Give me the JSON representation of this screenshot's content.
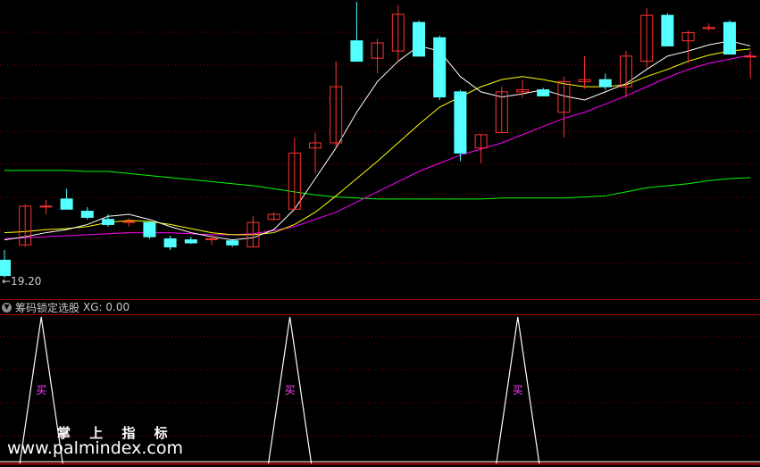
{
  "indicator": {
    "name": "筹码锁定选股",
    "output": "XG: 0.00",
    "signal_label": "买"
  },
  "watermark": {
    "line1": "掌 上 指 标",
    "line2": "www.palmindex.com"
  },
  "low_marker": "←19.20",
  "colors": {
    "up": "#ff3232",
    "down": "#54ffff",
    "ma5": "#ffffff",
    "ma10": "#ffff00",
    "ma20": "#ff00ff",
    "ma60": "#00ff00",
    "grid": "#8b0000",
    "border": "#b00000"
  },
  "chart_data": {
    "type": "candlestick",
    "price_range": [
      19.1,
      21.9
    ],
    "candles": [
      {
        "o": 19.35,
        "h": 19.45,
        "l": 19.18,
        "c": 19.2
      },
      {
        "o": 19.5,
        "h": 19.9,
        "l": 19.48,
        "c": 19.88
      },
      {
        "o": 19.88,
        "h": 19.94,
        "l": 19.8,
        "c": 19.88
      },
      {
        "o": 19.95,
        "h": 20.05,
        "l": 19.85,
        "c": 19.85
      },
      {
        "o": 19.83,
        "h": 19.87,
        "l": 19.75,
        "c": 19.77
      },
      {
        "o": 19.75,
        "h": 19.8,
        "l": 19.68,
        "c": 19.7
      },
      {
        "o": 19.72,
        "h": 19.76,
        "l": 19.68,
        "c": 19.73
      },
      {
        "o": 19.72,
        "h": 19.73,
        "l": 19.56,
        "c": 19.58
      },
      {
        "o": 19.56,
        "h": 19.59,
        "l": 19.45,
        "c": 19.48
      },
      {
        "o": 19.55,
        "h": 19.58,
        "l": 19.51,
        "c": 19.52
      },
      {
        "o": 19.56,
        "h": 19.6,
        "l": 19.5,
        "c": 19.56
      },
      {
        "o": 19.54,
        "h": 19.55,
        "l": 19.48,
        "c": 19.5
      },
      {
        "o": 19.48,
        "h": 19.78,
        "l": 19.48,
        "c": 19.72
      },
      {
        "o": 19.75,
        "h": 19.82,
        "l": 19.74,
        "c": 19.8
      },
      {
        "o": 19.85,
        "h": 20.55,
        "l": 19.85,
        "c": 20.4
      },
      {
        "o": 20.45,
        "h": 20.6,
        "l": 20.2,
        "c": 20.5
      },
      {
        "o": 20.5,
        "h": 21.3,
        "l": 20.45,
        "c": 21.05
      },
      {
        "o": 21.5,
        "h": 21.88,
        "l": 21.3,
        "c": 21.3
      },
      {
        "o": 21.33,
        "h": 21.52,
        "l": 21.18,
        "c": 21.48
      },
      {
        "o": 21.4,
        "h": 21.85,
        "l": 21.3,
        "c": 21.76
      },
      {
        "o": 21.68,
        "h": 21.7,
        "l": 21.35,
        "c": 21.35
      },
      {
        "o": 21.53,
        "h": 21.55,
        "l": 20.92,
        "c": 20.95
      },
      {
        "o": 21.0,
        "h": 21.02,
        "l": 20.32,
        "c": 20.4
      },
      {
        "o": 20.45,
        "h": 20.58,
        "l": 20.3,
        "c": 20.58
      },
      {
        "o": 20.6,
        "h": 21.05,
        "l": 20.6,
        "c": 21.0
      },
      {
        "o": 21.0,
        "h": 21.12,
        "l": 20.95,
        "c": 21.02
      },
      {
        "o": 21.02,
        "h": 21.04,
        "l": 20.96,
        "c": 20.96
      },
      {
        "o": 20.8,
        "h": 21.15,
        "l": 20.55,
        "c": 21.1
      },
      {
        "o": 21.1,
        "h": 21.35,
        "l": 21.03,
        "c": 21.12
      },
      {
        "o": 21.12,
        "h": 21.18,
        "l": 21.02,
        "c": 21.05
      },
      {
        "o": 21.05,
        "h": 21.4,
        "l": 20.95,
        "c": 21.35
      },
      {
        "o": 21.3,
        "h": 21.82,
        "l": 21.23,
        "c": 21.75
      },
      {
        "o": 21.75,
        "h": 21.77,
        "l": 21.45,
        "c": 21.45
      },
      {
        "o": 21.5,
        "h": 21.6,
        "l": 21.28,
        "c": 21.58
      },
      {
        "o": 21.62,
        "h": 21.67,
        "l": 21.6,
        "c": 21.63
      },
      {
        "o": 21.68,
        "h": 21.7,
        "l": 21.37,
        "c": 21.37
      },
      {
        "o": 21.35,
        "h": 21.4,
        "l": 21.13,
        "c": 21.35
      }
    ],
    "ma5": [
      19.55,
      19.58,
      19.62,
      19.65,
      19.7,
      19.78,
      19.8,
      19.75,
      19.68,
      19.62,
      19.58,
      19.55,
      19.57,
      19.65,
      19.85,
      20.15,
      20.45,
      20.8,
      21.1,
      21.3,
      21.45,
      21.4,
      21.15,
      21.0,
      20.95,
      20.98,
      21.02,
      20.96,
      20.92,
      21.0,
      21.08,
      21.22,
      21.35,
      21.4,
      21.46,
      21.5,
      21.45
    ],
    "ma10": [
      19.62,
      19.63,
      19.65,
      19.66,
      19.68,
      19.72,
      19.74,
      19.73,
      19.7,
      19.66,
      19.62,
      19.6,
      19.6,
      19.62,
      19.7,
      19.82,
      19.98,
      20.15,
      20.32,
      20.5,
      20.68,
      20.85,
      20.95,
      21.05,
      21.12,
      21.15,
      21.12,
      21.08,
      21.05,
      21.05,
      21.07,
      21.15,
      21.22,
      21.3,
      21.36,
      21.4,
      21.42
    ],
    "ma20": [
      19.56,
      19.57,
      19.58,
      19.59,
      19.6,
      19.61,
      19.62,
      19.62,
      19.62,
      19.61,
      19.6,
      19.6,
      19.61,
      19.64,
      19.68,
      19.75,
      19.82,
      19.92,
      20.02,
      20.12,
      20.22,
      20.3,
      20.38,
      20.44,
      20.5,
      20.58,
      20.66,
      20.74,
      20.8,
      20.88,
      20.96,
      21.05,
      21.14,
      21.22,
      21.28,
      21.32,
      21.36
    ],
    "ma60": [
      20.23,
      20.23,
      20.23,
      20.23,
      20.22,
      20.22,
      20.2,
      20.18,
      20.16,
      20.14,
      20.12,
      20.1,
      20.08,
      20.05,
      20.02,
      19.99,
      19.97,
      19.96,
      19.95,
      19.95,
      19.95,
      19.95,
      19.95,
      19.95,
      19.96,
      19.96,
      19.96,
      19.96,
      19.97,
      19.98,
      20.02,
      20.06,
      20.08,
      20.1,
      20.13,
      20.15,
      20.16
    ],
    "signal": [
      0,
      1,
      0,
      0,
      0,
      0,
      0,
      0,
      0,
      0,
      0,
      0,
      0,
      1,
      0,
      0,
      0,
      0,
      0,
      0,
      0,
      0,
      0,
      0,
      1,
      0,
      0,
      0,
      0,
      0,
      0,
      0,
      0,
      0,
      0,
      0,
      0
    ]
  }
}
